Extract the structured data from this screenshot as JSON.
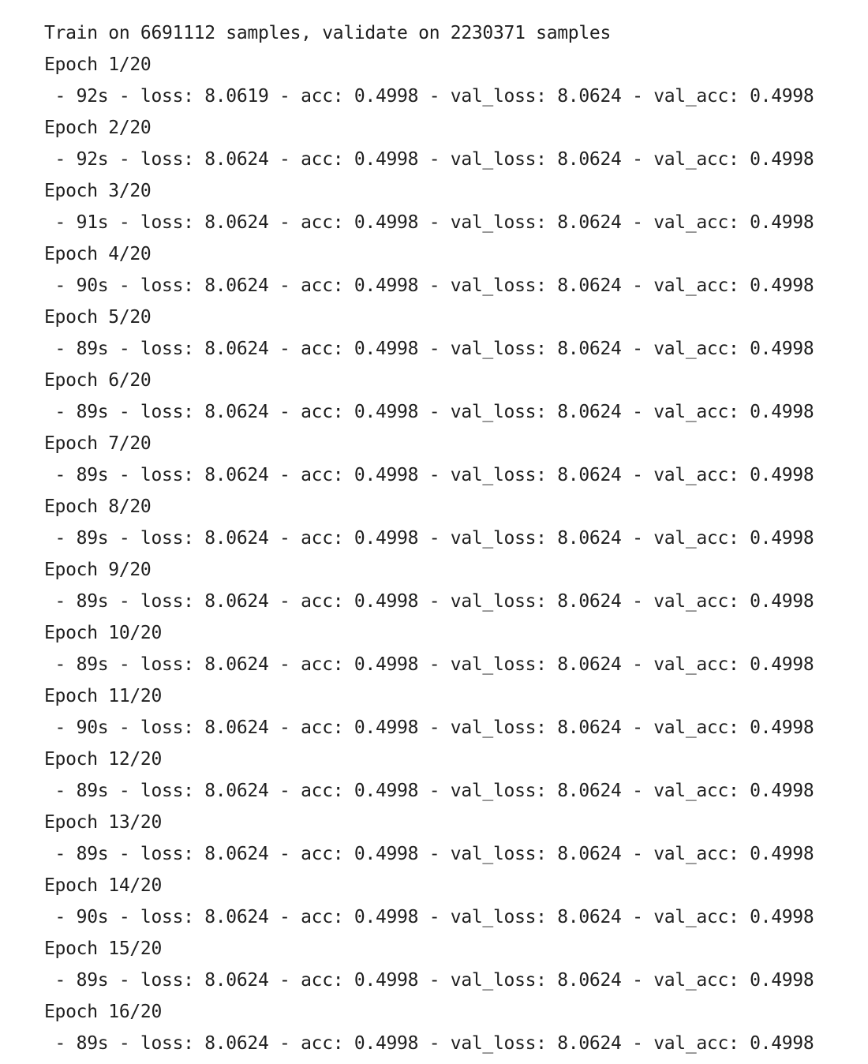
{
  "header_line": "Train on 6691112 samples, validate on 2230371 samples",
  "epochs": [
    {
      "header": "Epoch 1/20",
      "metrics": " - 92s - loss: 8.0619 - acc: 0.4998 - val_loss: 8.0624 - val_acc: 0.4998"
    },
    {
      "header": "Epoch 2/20",
      "metrics": " - 92s - loss: 8.0624 - acc: 0.4998 - val_loss: 8.0624 - val_acc: 0.4998"
    },
    {
      "header": "Epoch 3/20",
      "metrics": " - 91s - loss: 8.0624 - acc: 0.4998 - val_loss: 8.0624 - val_acc: 0.4998"
    },
    {
      "header": "Epoch 4/20",
      "metrics": " - 90s - loss: 8.0624 - acc: 0.4998 - val_loss: 8.0624 - val_acc: 0.4998"
    },
    {
      "header": "Epoch 5/20",
      "metrics": " - 89s - loss: 8.0624 - acc: 0.4998 - val_loss: 8.0624 - val_acc: 0.4998"
    },
    {
      "header": "Epoch 6/20",
      "metrics": " - 89s - loss: 8.0624 - acc: 0.4998 - val_loss: 8.0624 - val_acc: 0.4998"
    },
    {
      "header": "Epoch 7/20",
      "metrics": " - 89s - loss: 8.0624 - acc: 0.4998 - val_loss: 8.0624 - val_acc: 0.4998"
    },
    {
      "header": "Epoch 8/20",
      "metrics": " - 89s - loss: 8.0624 - acc: 0.4998 - val_loss: 8.0624 - val_acc: 0.4998"
    },
    {
      "header": "Epoch 9/20",
      "metrics": " - 89s - loss: 8.0624 - acc: 0.4998 - val_loss: 8.0624 - val_acc: 0.4998"
    },
    {
      "header": "Epoch 10/20",
      "metrics": " - 89s - loss: 8.0624 - acc: 0.4998 - val_loss: 8.0624 - val_acc: 0.4998"
    },
    {
      "header": "Epoch 11/20",
      "metrics": " - 90s - loss: 8.0624 - acc: 0.4998 - val_loss: 8.0624 - val_acc: 0.4998"
    },
    {
      "header": "Epoch 12/20",
      "metrics": " - 89s - loss: 8.0624 - acc: 0.4998 - val_loss: 8.0624 - val_acc: 0.4998"
    },
    {
      "header": "Epoch 13/20",
      "metrics": " - 89s - loss: 8.0624 - acc: 0.4998 - val_loss: 8.0624 - val_acc: 0.4998"
    },
    {
      "header": "Epoch 14/20",
      "metrics": " - 90s - loss: 8.0624 - acc: 0.4998 - val_loss: 8.0624 - val_acc: 0.4998"
    },
    {
      "header": "Epoch 15/20",
      "metrics": " - 89s - loss: 8.0624 - acc: 0.4998 - val_loss: 8.0624 - val_acc: 0.4998"
    },
    {
      "header": "Epoch 16/20",
      "metrics": " - 89s - loss: 8.0624 - acc: 0.4998 - val_loss: 8.0624 - val_acc: 0.4998"
    }
  ]
}
